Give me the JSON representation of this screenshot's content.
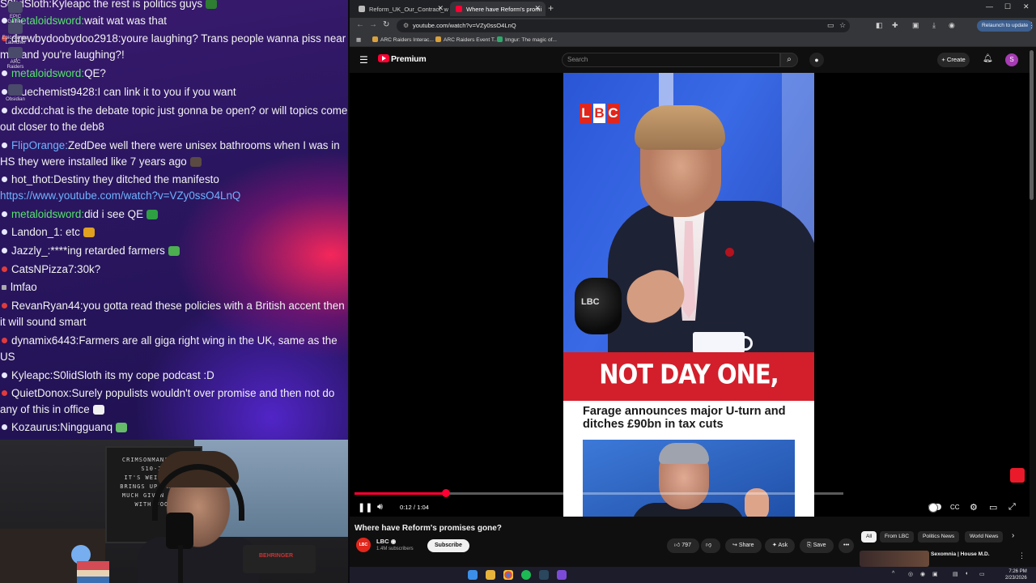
{
  "chat": [
    {
      "dot": "",
      "user": "S0lidSloth",
      "user_color": "white",
      "msg": "Kyleapc the rest is politics guys",
      "emote": "#2e7d32"
    },
    {
      "dot": "white",
      "user": "metaloidsword",
      "user_color": "green",
      "msg": "wait wat was that"
    },
    {
      "dot": "red",
      "user": "drewbydoobydoo2918",
      "user_color": "white",
      "msg": "youre laughing? Trans people wanna piss near me, and you're laughing?!"
    },
    {
      "dot": "white",
      "user": "metaloidsword",
      "user_color": "green",
      "msg": "QE?"
    },
    {
      "dot": "white",
      "user": "Bluechemist9428",
      "user_color": "white",
      "msg": "I can link it to you if you want"
    },
    {
      "dot": "white",
      "user": "dxcdd",
      "user_color": "white",
      "msg": "chat is the debate topic just gonna be open? or will topics come out closer to the deb8"
    },
    {
      "dot": "white",
      "user": "FlipOrange",
      "user_color": "blue",
      "msg": "ZedDee well there were unisex bathrooms when I was in HS they were installed like 7 years ago",
      "emote": "#5a4a42"
    },
    {
      "dot": "white",
      "user": "hot_thot",
      "user_color": "white",
      "msg": "Destiny they ditched the manifesto",
      "link": "https://www.youtube.com/watch?v=VZy0ssO4LnQ"
    },
    {
      "dot": "white",
      "user": "metaloidsword",
      "user_color": "green",
      "msg": "did i see QE",
      "emote": "#2ea043"
    },
    {
      "dot": "white",
      "user": "Landon_1",
      "user_color": "white",
      "msg": " etc",
      "emote": "#e0a020"
    },
    {
      "dot": "white",
      "user": "Jazzly_",
      "user_color": "white",
      "msg": "****ing retarded farmers",
      "emote": "#4caf50"
    },
    {
      "dot": "red",
      "user": "CatsNPizza7",
      "user_color": "white",
      "msg": "30k?"
    },
    {
      "dot": "grey",
      "user": "",
      "user_color": "white",
      "msg": "lmfao"
    },
    {
      "dot": "red",
      "user": "RevanRyan44",
      "user_color": "white",
      "msg": "you gotta read these policies with a British accent then it will sound smart"
    },
    {
      "dot": "red",
      "user": "dynamix6443",
      "user_color": "white",
      "msg": "Farmers are all giga right wing in the UK, same as the US"
    },
    {
      "dot": "white",
      "user": "Kyleapc",
      "user_color": "white",
      "msg": "S0lidSloth its my cope podcast :D"
    },
    {
      "dot": "red",
      "user": "QuietDonox",
      "user_color": "white",
      "msg": "Surely populists wouldn't over promise and then not do any of this in office",
      "emote": "#f0f0f0"
    },
    {
      "dot": "white",
      "user": "Kozaurus",
      "user_color": "white",
      "msg": "Ningguanq",
      "emote": "#66bb6a"
    }
  ],
  "desktop_icons": [
    {
      "label": "EPIC\nGames"
    },
    {
      "label": "Epic Games\nLauncher"
    },
    {
      "label": "ARC Raiders"
    },
    {
      "label": "Obsidian"
    }
  ],
  "webcam": {
    "board_text": [
      "CRIMSONMANA DON",
      "S10-20",
      "IT'S WEIRD HOW",
      "BRINGS UP THATCH",
      "MUCH GIVEN SOME",
      "WITH FOOD"
    ],
    "device_brand": "BEHRINGER"
  },
  "browser": {
    "tabs": [
      {
        "title": "Reform_UK_Our_Contract_with_",
        "active": false,
        "favicon": "doc"
      },
      {
        "title": "Where have Reform's promi",
        "active": true,
        "favicon": "yt"
      }
    ],
    "new_tab": "+",
    "window_controls": [
      "—",
      "☐",
      "✕"
    ],
    "url": "youtube.com/watch?v=VZy0ssO4LnQ",
    "relaunch_label": "Relaunch to update",
    "bookmarks": [
      "ARC Raiders Interac...",
      "ARC Raiders Event T...",
      "Imgur: The magic of..."
    ]
  },
  "youtube": {
    "brand": "Premium",
    "search_placeholder": "Search",
    "create_label": "Create",
    "avatar_letter": "S",
    "video": {
      "logo_letters": [
        "L",
        "B",
        "C"
      ],
      "mic_label": "LBC",
      "banner": "NOT DAY ONE,",
      "headline": "Farage announces major U-turn and ditches £90bn in tax cuts",
      "progress": 0.1875,
      "time": "0:12 / 1:04"
    },
    "title": "Where have Reform's promises gone?",
    "channel": {
      "name": "LBC",
      "subscribers": "1.4M subscribers",
      "avatar_text": "LBC"
    },
    "subscribe_label": "Subscribe",
    "actions": {
      "likes": "797",
      "share": "Share",
      "ask": "Ask",
      "save": "Save",
      "more": "•••"
    },
    "chips": [
      "All",
      "From LBC",
      "Politics News",
      "World News"
    ],
    "recommended_title": "Sexomnia | House M.D."
  },
  "taskbar": {
    "clock_time": "7:26 PM",
    "clock_date": "2/23/2026"
  },
  "colors": {
    "youtube_red": "#ff0033",
    "lbc_red": "#e1261c",
    "chat_green": "#56e36c",
    "chat_blue": "#6fb3ff"
  }
}
